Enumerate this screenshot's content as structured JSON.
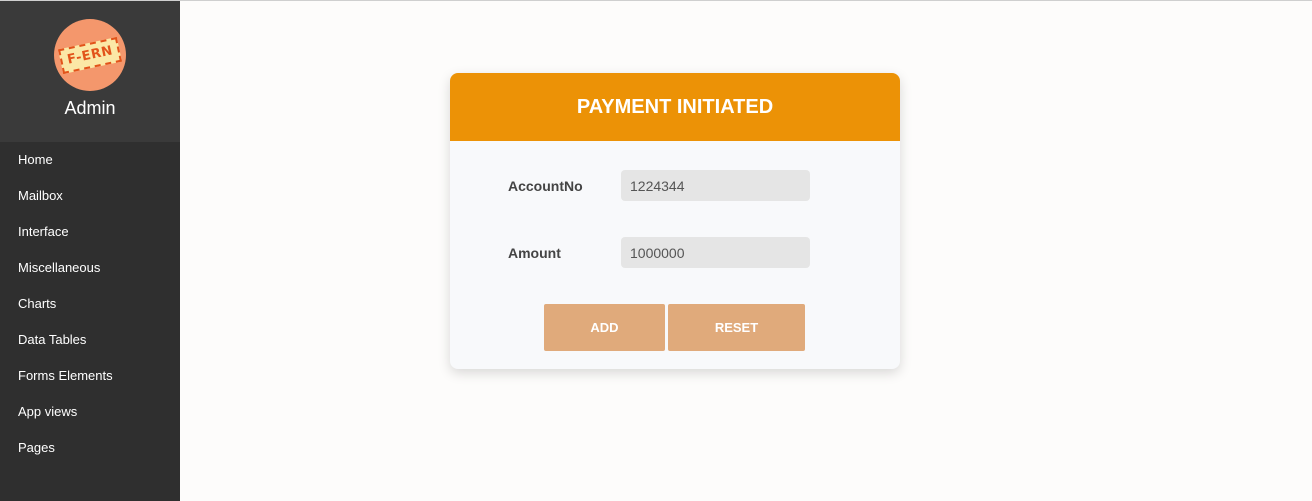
{
  "sidebar": {
    "logo_text": "F-ERN",
    "user_name": "Admin",
    "items": [
      {
        "label": "Home"
      },
      {
        "label": "Mailbox"
      },
      {
        "label": "Interface"
      },
      {
        "label": "Miscellaneous"
      },
      {
        "label": "Charts"
      },
      {
        "label": "Data Tables"
      },
      {
        "label": "Forms Elements"
      },
      {
        "label": "App views"
      },
      {
        "label": "Pages"
      }
    ]
  },
  "form": {
    "title": "PAYMENT INITIATED",
    "account": {
      "label": "AccountNo",
      "value": "1224344"
    },
    "amount": {
      "label": "Amount",
      "value": "1000000"
    },
    "add_label": "ADD",
    "reset_label": "RESET"
  },
  "colors": {
    "header": "#ec9206",
    "button": "#e0aa7b",
    "sidebar": "#2f2f2f"
  }
}
